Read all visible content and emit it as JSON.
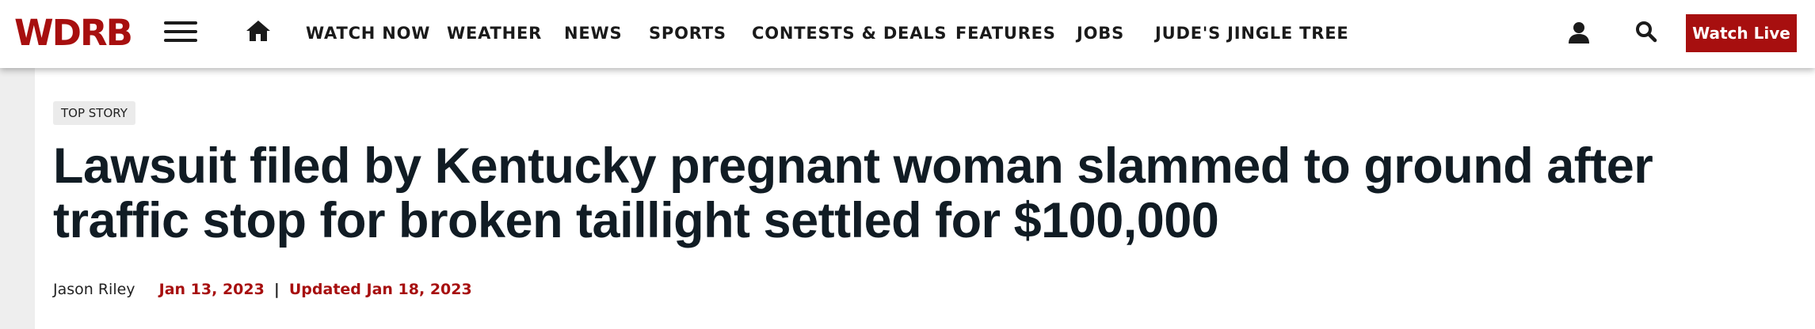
{
  "colors": {
    "brand_red": "#a70f0f",
    "text_dark": "#111c24",
    "gutter_gray": "#eeeeee"
  },
  "header": {
    "logo_text": "WDRB",
    "menu_icon": "hamburger-menu-icon",
    "home_icon": "home-icon",
    "nav_items": [
      {
        "label": "WATCH NOW"
      },
      {
        "label": "WEATHER"
      },
      {
        "label": "NEWS"
      },
      {
        "label": "SPORTS"
      },
      {
        "label": "CONTESTS & DEALS"
      },
      {
        "label": "FEATURES"
      },
      {
        "label": "JOBS"
      },
      {
        "label": "JUDE'S JINGLE TREE"
      }
    ],
    "user_icon": "user-icon",
    "search_icon": "search-icon",
    "watch_live_label": "Watch Live"
  },
  "article": {
    "badge": "TOP STORY",
    "headline": "Lawsuit filed by Kentucky pregnant woman slammed to ground after traffic stop for broken taillight settled for $100,000",
    "author": "Jason Riley",
    "published": "Jan 13, 2023",
    "separator": "|",
    "updated": "Updated Jan 18, 2023"
  }
}
